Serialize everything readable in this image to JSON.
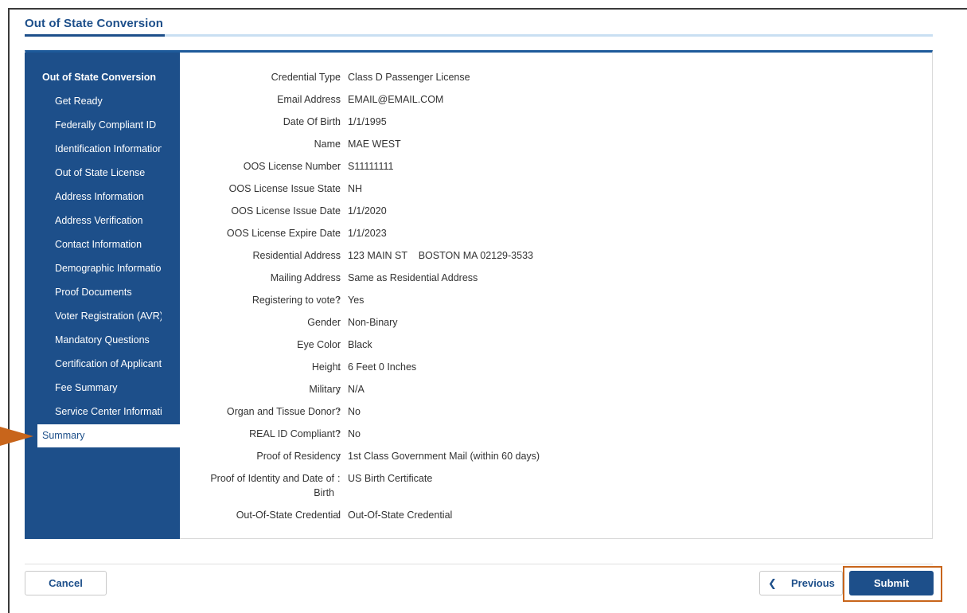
{
  "page": {
    "title": "Out of State Conversion"
  },
  "sidebar": {
    "heading": "Out of State Conversion",
    "items": [
      {
        "label": "Get Ready"
      },
      {
        "label": "Federally Compliant ID"
      },
      {
        "label": "Identification Information"
      },
      {
        "label": "Out of State License"
      },
      {
        "label": "Address Information"
      },
      {
        "label": "Address Verification"
      },
      {
        "label": "Contact Information"
      },
      {
        "label": "Demographic Information"
      },
      {
        "label": "Proof Documents"
      },
      {
        "label": "Voter Registration (AVR)"
      },
      {
        "label": "Mandatory Questions"
      },
      {
        "label": "Certification of Applicant"
      },
      {
        "label": "Fee Summary"
      },
      {
        "label": "Service Center Information"
      }
    ],
    "active": {
      "label": "Summary"
    }
  },
  "summary": {
    "rows": [
      {
        "label": "Credential Type",
        "value": "Class D Passenger License"
      },
      {
        "label": "Email Address",
        "value": "EMAIL@EMAIL.COM"
      },
      {
        "label": "Date Of Birth",
        "value": "1/1/1995"
      },
      {
        "label": "Name",
        "value": "MAE WEST"
      },
      {
        "label": "OOS License Number",
        "value": "S11111111"
      },
      {
        "label": "OOS License Issue State",
        "value": "NH"
      },
      {
        "label": "OOS License Issue Date",
        "value": "1/1/2020"
      },
      {
        "label": "OOS License Expire Date",
        "value": "1/1/2023"
      },
      {
        "label": "Residential Address",
        "value": "123 MAIN ST    BOSTON MA 02129-3533"
      },
      {
        "label": "Mailing Address",
        "value": "Same as Residential Address"
      },
      {
        "label": "Registering to vote?",
        "value": "Yes"
      },
      {
        "label": "Gender",
        "value": "Non-Binary"
      },
      {
        "label": "Eye Color",
        "value": "Black"
      },
      {
        "label": "Height",
        "value": "6 Feet 0 Inches"
      },
      {
        "label": "Military",
        "value": "N/A"
      },
      {
        "label": "Organ and Tissue Donor?",
        "value": "No"
      },
      {
        "label": "REAL ID Compliant?",
        "value": "No"
      },
      {
        "label": "Proof of Residency",
        "value": "1st Class Government Mail (within 60 days)"
      },
      {
        "label": "Proof of Identity and Date of Birth",
        "value": "US Birth Certificate"
      },
      {
        "label": "Out-Of-State Credential",
        "value": "Out-Of-State Credential"
      }
    ],
    "colon": ":"
  },
  "footer": {
    "cancel_label": "Cancel",
    "previous_label": "Previous",
    "previous_icon": "chevron-left-icon",
    "submit_label": "Submit"
  },
  "colors": {
    "brand": "#1d4f8a",
    "highlight": "#c8651b"
  }
}
